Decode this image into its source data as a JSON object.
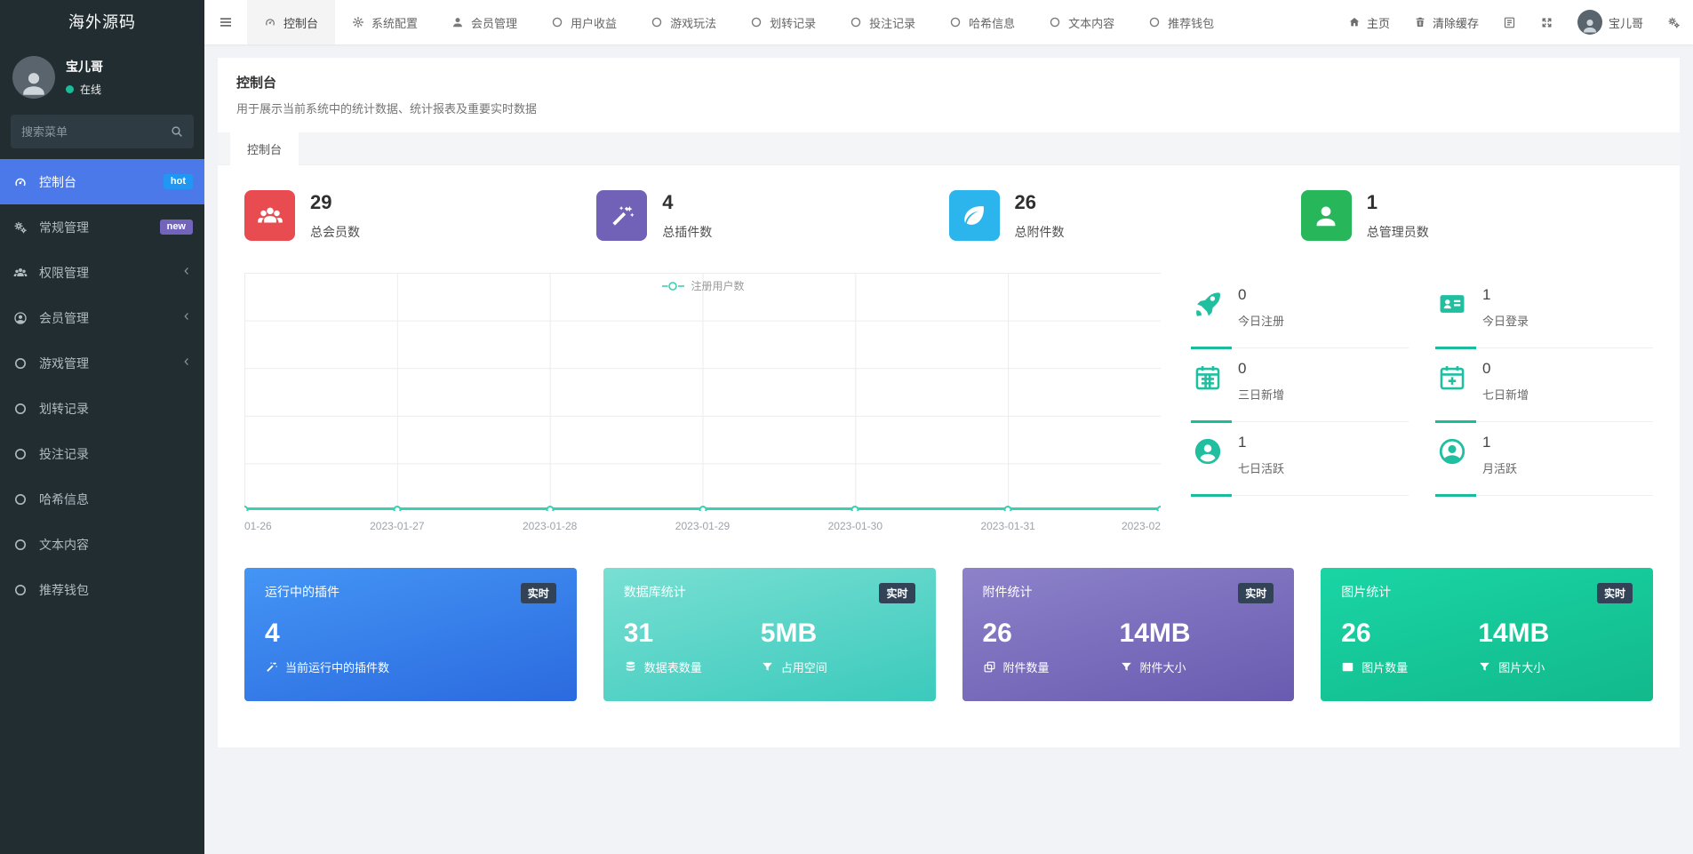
{
  "sidebar": {
    "logo_text": "海外源码",
    "user": {
      "name": "宝儿哥",
      "status": "在线"
    },
    "search_placeholder": "搜索菜单",
    "items": [
      {
        "label": "控制台",
        "icon": "tachometer-icon",
        "badge": "hot",
        "active": true
      },
      {
        "label": "常规管理",
        "icon": "cogs-icon",
        "badge": "new",
        "active": false
      },
      {
        "label": "权限管理",
        "icon": "users-icon",
        "expandable": true,
        "active": false
      },
      {
        "label": "会员管理",
        "icon": "user-circle-icon",
        "expandable": true,
        "active": false
      },
      {
        "label": "游戏管理",
        "icon": "circle-icon",
        "expandable": true,
        "active": false
      },
      {
        "label": "划转记录",
        "icon": "circle-icon",
        "active": false
      },
      {
        "label": "投注记录",
        "icon": "circle-icon",
        "active": false
      },
      {
        "label": "哈希信息",
        "icon": "circle-icon",
        "active": false
      },
      {
        "label": "文本内容",
        "icon": "circle-icon",
        "active": false
      },
      {
        "label": "推荐钱包",
        "icon": "circle-icon",
        "active": false
      }
    ]
  },
  "topbar": {
    "tabs": [
      {
        "label": "控制台",
        "icon": "tachometer-icon",
        "active": true
      },
      {
        "label": "系统配置",
        "icon": "gear-icon",
        "active": false
      },
      {
        "label": "会员管理",
        "icon": "user-icon",
        "active": false
      },
      {
        "label": "用户收益",
        "icon": "circle-icon",
        "active": false
      },
      {
        "label": "游戏玩法",
        "icon": "circle-icon",
        "active": false
      },
      {
        "label": "划转记录",
        "icon": "circle-icon",
        "active": false
      },
      {
        "label": "投注记录",
        "icon": "circle-icon",
        "active": false
      },
      {
        "label": "哈希信息",
        "icon": "circle-icon",
        "active": false
      },
      {
        "label": "文本内容",
        "icon": "circle-icon",
        "active": false
      },
      {
        "label": "推荐钱包",
        "icon": "circle-icon",
        "active": false
      }
    ],
    "actions": {
      "home_label": "主页",
      "clear_cache_label": "清除缓存",
      "username": "宝儿哥"
    }
  },
  "page_header": {
    "title": "控制台",
    "subtitle": "用于展示当前系统中的统计数据、统计报表及重要实时数据"
  },
  "content_tabs": [
    {
      "label": "控制台",
      "active": true
    }
  ],
  "stat_cards": [
    {
      "value": "29",
      "label": "总会员数",
      "icon": "users-icon",
      "color": "#e84c51"
    },
    {
      "value": "4",
      "label": "总插件数",
      "icon": "magic-wand-icon",
      "color": "#7162b8"
    },
    {
      "value": "26",
      "label": "总附件数",
      "icon": "leaf-icon",
      "color": "#2cb5ec"
    },
    {
      "value": "1",
      "label": "总管理员数",
      "icon": "user-icon",
      "color": "#27b65a"
    }
  ],
  "chart_data": {
    "type": "line",
    "title": "",
    "legend": [
      "注册用户数"
    ],
    "legend_position": "top-center",
    "x_labels": [
      "01-26",
      "2023-01-27",
      "2023-01-28",
      "2023-01-29",
      "2023-01-30",
      "2023-01-31",
      "2023-02"
    ],
    "series": [
      {
        "name": "注册用户数",
        "values": [
          0,
          0,
          0,
          0,
          0,
          0,
          0
        ],
        "color": "#38d1b4",
        "marker": "circle"
      }
    ],
    "ylim": [
      0,
      5
    ],
    "grid": true,
    "y_axis_labels_visible": false
  },
  "mini_stats": [
    {
      "value": "0",
      "label": "今日注册",
      "icon": "rocket-icon"
    },
    {
      "value": "1",
      "label": "今日登录",
      "icon": "id-card-icon"
    },
    {
      "value": "0",
      "label": "三日新增",
      "icon": "calendar-icon"
    },
    {
      "value": "0",
      "label": "七日新增",
      "icon": "calendar-plus-icon"
    },
    {
      "value": "1",
      "label": "七日活跃",
      "icon": "user-solid-circle-icon"
    },
    {
      "value": "1",
      "label": "月活跃",
      "icon": "user-outline-circle-icon"
    }
  ],
  "gradient_cards": [
    {
      "title": "运行中的插件",
      "badge": "实时",
      "values": [
        {
          "value": "4",
          "label": "当前运行中的插件数",
          "icon": "magic-wand-icon"
        }
      ],
      "gradient": [
        "#4495f5",
        "#2b6adf"
      ]
    },
    {
      "title": "数据库统计",
      "badge": "实时",
      "values": [
        {
          "value": "31",
          "label": "数据表数量",
          "icon": "database-icon"
        },
        {
          "value": "5MB",
          "label": "占用空间",
          "icon": "filter-icon"
        }
      ],
      "gradient": [
        "#79dfd3",
        "#3bcabc"
      ]
    },
    {
      "title": "附件统计",
      "badge": "实时",
      "values": [
        {
          "value": "26",
          "label": "附件数量",
          "icon": "clone-icon"
        },
        {
          "value": "14MB",
          "label": "附件大小",
          "icon": "filter-icon"
        }
      ],
      "gradient": [
        "#8d82ca",
        "#695bb0"
      ]
    },
    {
      "title": "图片统计",
      "badge": "实时",
      "values": [
        {
          "value": "26",
          "label": "图片数量",
          "icon": "image-icon"
        },
        {
          "value": "14MB",
          "label": "图片大小",
          "icon": "filter-icon"
        }
      ],
      "gradient": [
        "#1ad5a5",
        "#12b98b"
      ]
    }
  ],
  "theme": {
    "sidebar_bg": "#222d32",
    "active_menu_blue": "#4b79e9",
    "hot_badge_blue": "#2196f3",
    "new_badge_purple": "#7264ba",
    "accent_teal": "#1abc9c",
    "page_bg": "#f1f3f6",
    "realtime_badge_bg": "#324257"
  }
}
